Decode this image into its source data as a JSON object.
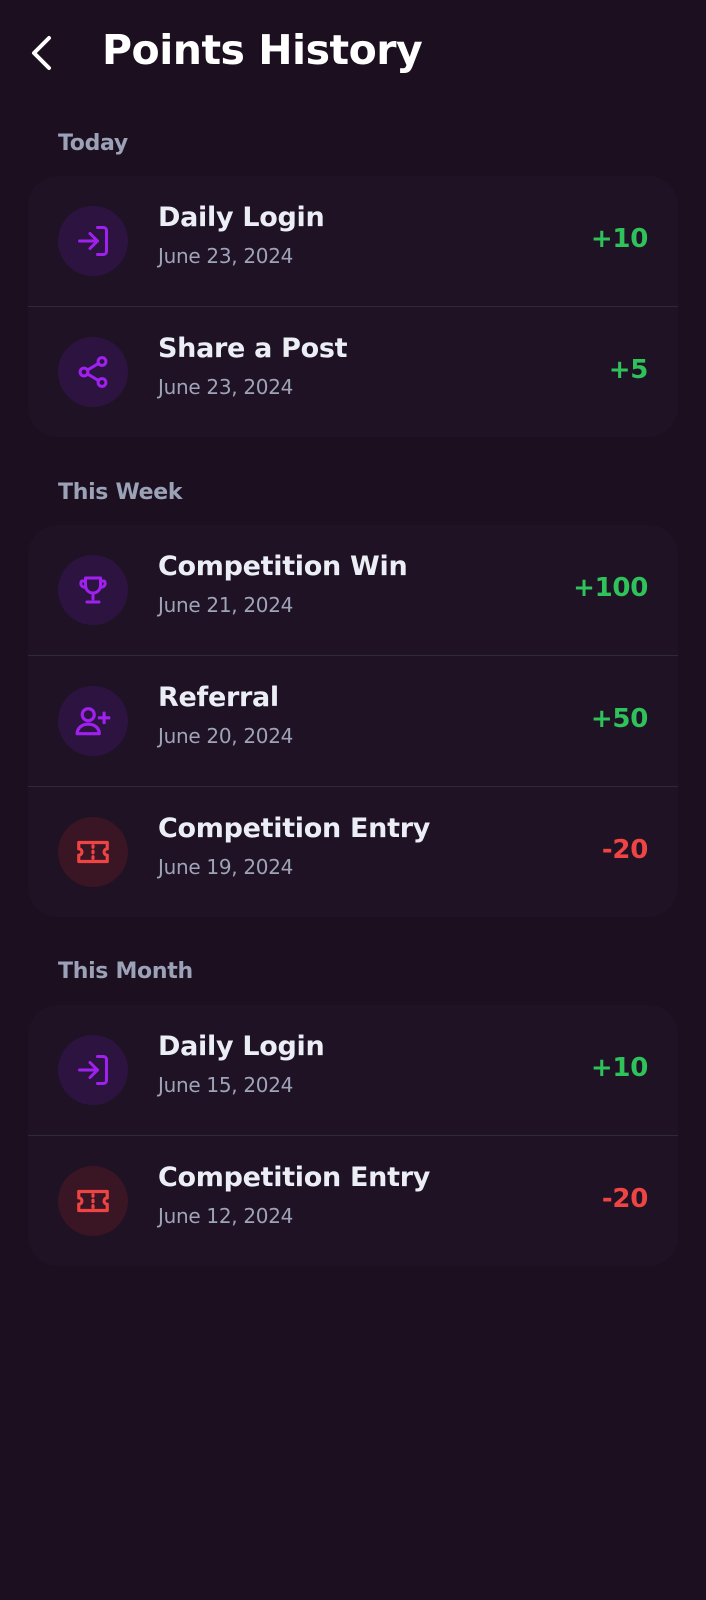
{
  "header": {
    "title": "Points History",
    "back_icon": "chevron-left-icon"
  },
  "colors": {
    "background": "#1c1020",
    "card": "#1e1224",
    "accent_purple": "#a020f0",
    "positive": "#2fc25b",
    "negative": "#ef4444"
  },
  "sections": [
    {
      "label": "Today",
      "items": [
        {
          "icon": "login-icon",
          "title": "Daily Login",
          "date": "June 23, 2024",
          "points": "+10"
        },
        {
          "icon": "share-icon",
          "title": "Share a Post",
          "date": "June 23, 2024",
          "points": "+5"
        }
      ]
    },
    {
      "label": "This Week",
      "items": [
        {
          "icon": "trophy-icon",
          "title": "Competition Win",
          "date": "June 21, 2024",
          "points": "+100"
        },
        {
          "icon": "user-plus-icon",
          "title": "Referral",
          "date": "June 20, 2024",
          "points": "+50"
        },
        {
          "icon": "ticket-icon",
          "title": "Competition Entry",
          "date": "June 19, 2024",
          "points": "-20"
        }
      ]
    },
    {
      "label": "This Month",
      "items": [
        {
          "icon": "login-icon",
          "title": "Daily Login",
          "date": "June 15, 2024",
          "points": "+10"
        },
        {
          "icon": "ticket-icon",
          "title": "Competition Entry",
          "date": "June 12, 2024",
          "points": "-20"
        }
      ]
    }
  ]
}
